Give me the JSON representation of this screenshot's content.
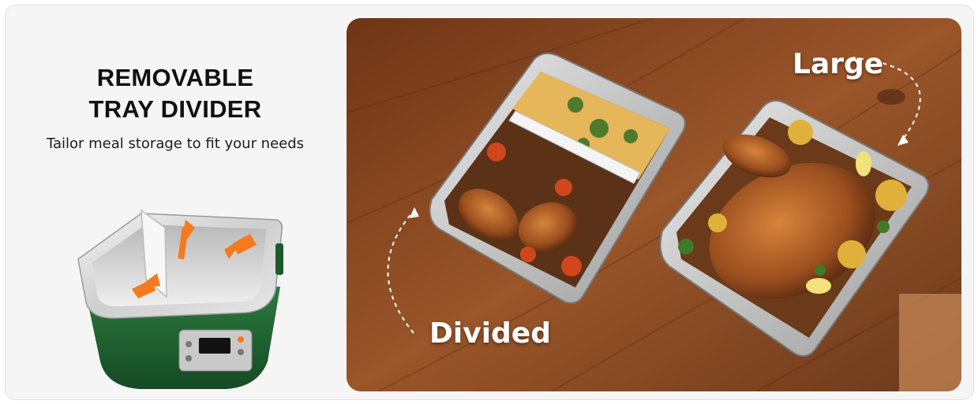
{
  "feature": {
    "title_line1": "REMOVABLE",
    "title_line2": "TRAY DIVIDER",
    "subtitle": "Tailor meal storage to fit your needs"
  },
  "photo": {
    "label_large": "Large",
    "label_divided": "Divided"
  },
  "colors": {
    "body_green": "#1f5a2f",
    "arrow_orange": "#f47a20",
    "wood": "#8a4a22",
    "panel_bg": "#f5f5f5"
  }
}
